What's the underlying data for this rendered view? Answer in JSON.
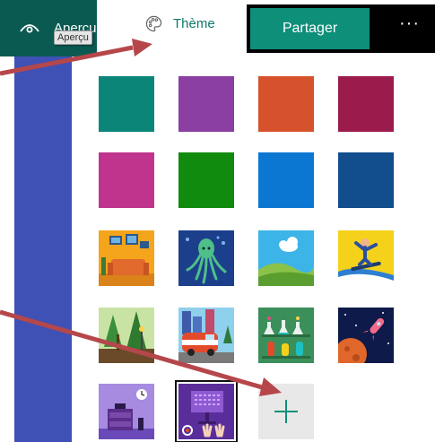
{
  "toolbar": {
    "preview_label": "Aperçu",
    "preview_tooltip": "Aperçu",
    "theme_label": "Thème",
    "share_label": "Partager",
    "more_label": "···"
  },
  "colors": {
    "preview_bg": "#0b5a52",
    "theme_text": "#0b7a68",
    "share_bg": "#0e8f7a",
    "sidebar": "#3f51b5",
    "annotation_arrow": "#b5474b"
  },
  "theme_swatches": [
    {
      "name": "teal",
      "color": "#0a8577"
    },
    {
      "name": "purple",
      "color": "#8b3fa2"
    },
    {
      "name": "orange",
      "color": "#d6522c"
    },
    {
      "name": "crimson",
      "color": "#9b1b4c"
    },
    {
      "name": "magenta",
      "color": "#c0348e"
    },
    {
      "name": "green",
      "color": "#108b0e"
    },
    {
      "name": "blue",
      "color": "#0b77d3"
    },
    {
      "name": "navy",
      "color": "#124e8e"
    }
  ],
  "theme_images": [
    {
      "name": "living-room-image"
    },
    {
      "name": "octopus-image"
    },
    {
      "name": "hills-cloud-image"
    },
    {
      "name": "snowboarder-image"
    },
    {
      "name": "forest-image"
    },
    {
      "name": "van-city-image"
    },
    {
      "name": "lab-flasks-image"
    },
    {
      "name": "space-rocket-image"
    },
    {
      "name": "desk-clock-image"
    },
    {
      "name": "presentation-image",
      "selected": true
    }
  ]
}
